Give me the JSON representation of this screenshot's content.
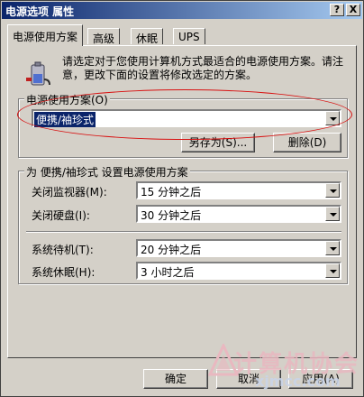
{
  "window": {
    "title": "电源选项 属性",
    "help_label": "?",
    "close_label": "X"
  },
  "tabs": [
    {
      "label": "电源使用方案",
      "active": true
    },
    {
      "label": "高级"
    },
    {
      "label": "休眠"
    },
    {
      "label": "UPS"
    }
  ],
  "intro_text": "请选定对于您使用计算机方式最适合的电源使用方案。请注意，更改下面的设置将修改选定的方案。",
  "scheme_group": {
    "label": "电源使用方案(O)",
    "selected": "便携/袖珍式",
    "save_as_label": "另存为(S)...",
    "delete_label": "删除(D)"
  },
  "settings_group": {
    "label": "为 便携/袖珍式 设置电源使用方案",
    "rows": [
      {
        "label": "关闭监视器(M):",
        "value": "15 分钟之后"
      },
      {
        "label": "关闭硬盘(I):",
        "value": "30 分钟之后"
      },
      {
        "label": "系统待机(T):",
        "value": "20 分钟之后"
      },
      {
        "label": "系统休眠(H):",
        "value": "3 小时之后"
      }
    ]
  },
  "footer": {
    "ok_label": "确定",
    "cancel_label": "取消",
    "apply_label": "应用(A)"
  },
  "watermark": {
    "text": "计算机协会",
    "url": "xjmcc.com"
  },
  "colors": {
    "titlebar": "#0a246a",
    "face": "#d4d0c8",
    "highlight_ellipse": "#d81010"
  }
}
